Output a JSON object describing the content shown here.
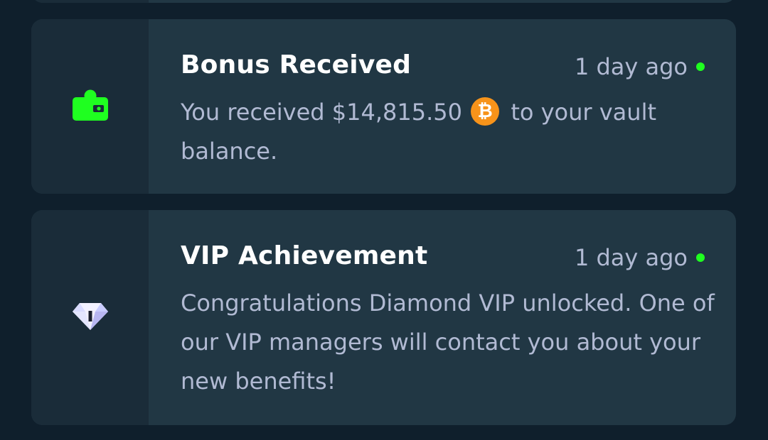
{
  "notifications": [
    {
      "title": "Bonus Received",
      "time": "1 day ago",
      "message_before": "You received $14,815.50",
      "currency_icon": "bitcoin-icon",
      "message_after": "to your vault balance.",
      "icon": "wallet-icon",
      "icon_color": "#1fff20",
      "unread": true
    },
    {
      "title": "VIP Achievement",
      "time": "1 day ago",
      "message": "Congratulations Diamond VIP unlocked. One of our VIP managers will contact you about your new benefits!",
      "icon": "diamond-icon",
      "unread": true
    }
  ],
  "colors": {
    "background": "#0f1f2c",
    "card": "#213744",
    "icon_column": "#1a2c39",
    "unread_dot": "#1fff20",
    "bitcoin": "#f7931a",
    "text_secondary": "#b1bad3"
  }
}
